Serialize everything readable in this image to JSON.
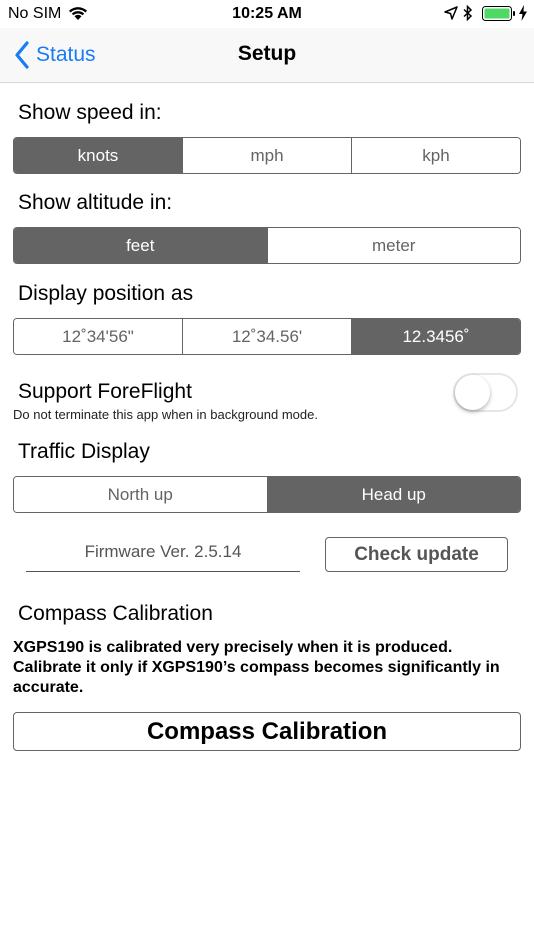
{
  "status_bar": {
    "carrier": "No SIM",
    "time": "10:25 AM"
  },
  "nav": {
    "back_label": "Status",
    "title": "Setup",
    "accent_color": "#1a7cf5"
  },
  "speed": {
    "label": "Show speed in:",
    "options": [
      "knots",
      "mph",
      "kph"
    ],
    "selected": "knots"
  },
  "altitude": {
    "label": "Show altitude in:",
    "options": [
      "feet",
      "meter"
    ],
    "selected": "feet"
  },
  "position": {
    "label": "Display position as",
    "options": [
      "12˚34'56\"",
      "12˚34.56'",
      "12.3456˚"
    ],
    "selected": "12.3456˚"
  },
  "foreflight": {
    "label": "Support ForeFlight",
    "sublabel": "Do not terminate this app when in background mode.",
    "enabled": false
  },
  "traffic": {
    "label": "Traffic Display",
    "options": [
      "North up",
      "Head up"
    ],
    "selected": "Head up"
  },
  "firmware": {
    "version_text": "Firmware Ver. 2.5.14",
    "check_label": "Check update"
  },
  "compass": {
    "label": "Compass Calibration",
    "description": "XGPS190 is calibrated very precisely when it is produced. Calibrate it only if XGPS190’s compass becomes significantly in accurate.",
    "button_label": "Compass Calibration"
  },
  "colors": {
    "segment_selected": "#646464",
    "battery_green": "#4cd964"
  }
}
